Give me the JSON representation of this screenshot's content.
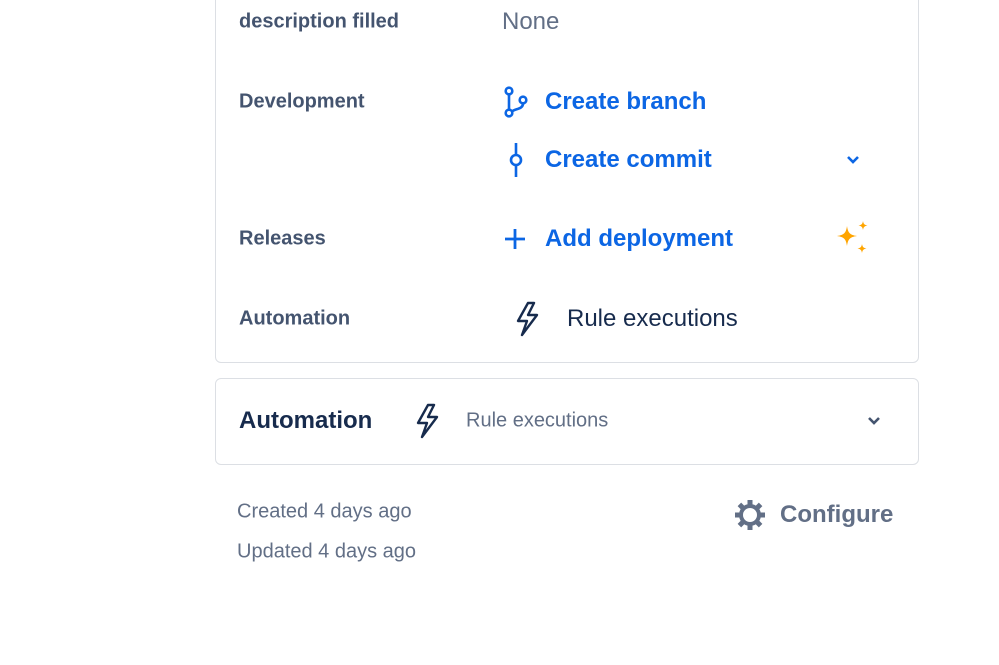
{
  "details": {
    "rows": [
      {
        "label": "description filled",
        "value": "None"
      },
      {
        "label": "Development",
        "actions": [
          "Create branch",
          "Create commit"
        ]
      },
      {
        "label": "Releases",
        "action": "Add deployment"
      },
      {
        "label": "Automation",
        "value": "Rule executions"
      }
    ]
  },
  "automation_panel": {
    "title": "Automation",
    "value": "Rule executions"
  },
  "footer": {
    "created": "Created 4 days ago",
    "updated": "Updated 4 days ago",
    "configure": "Configure"
  },
  "colors": {
    "link": "#0c66e4",
    "label": "#44546f",
    "ai": "#ffa500"
  }
}
